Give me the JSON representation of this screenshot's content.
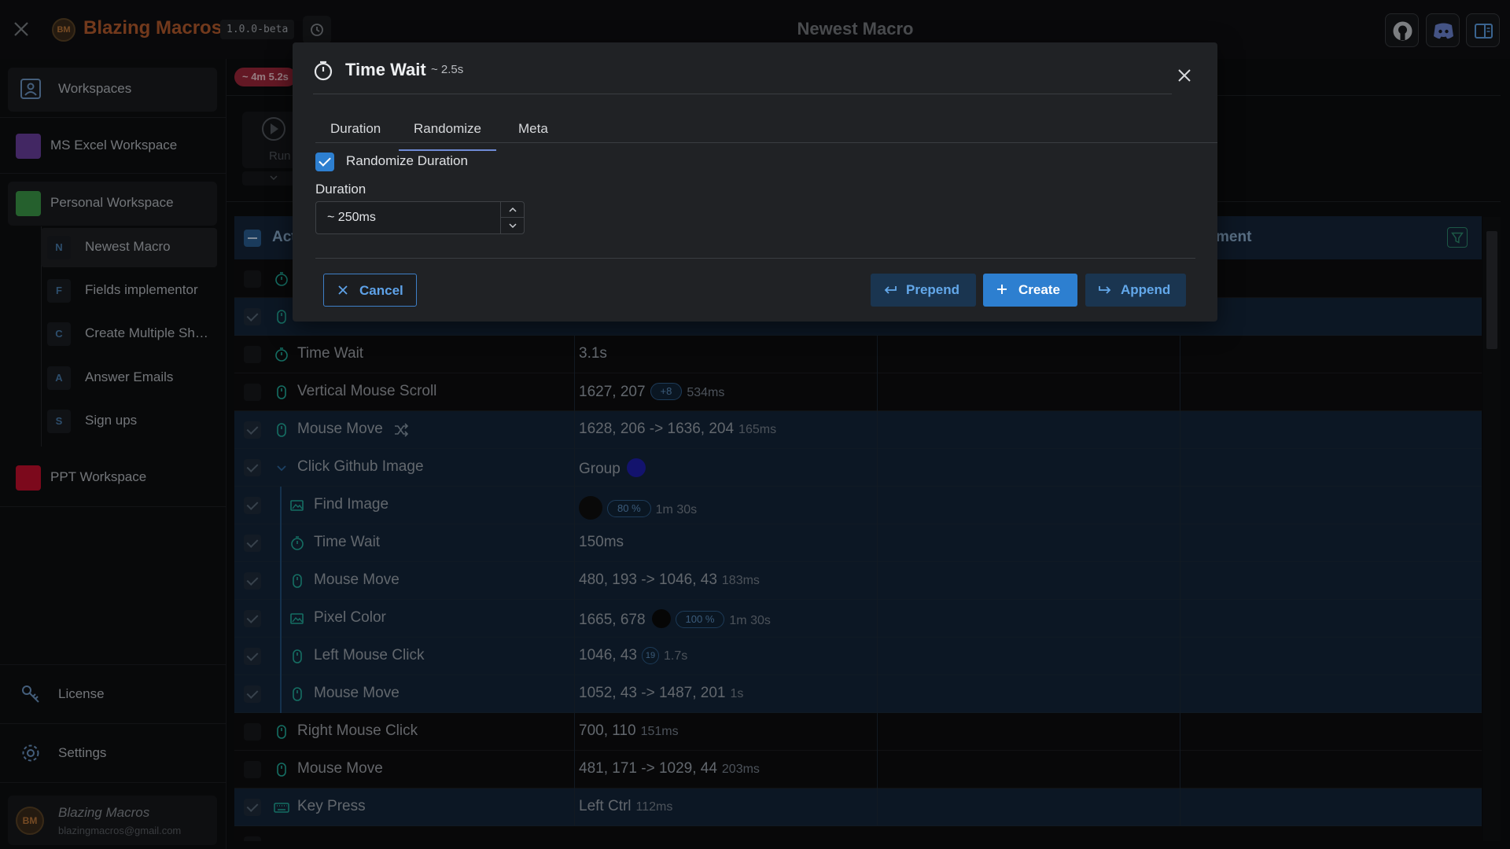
{
  "app": {
    "logo_text": "BM",
    "name": "Blazing Macros",
    "version": "1.0.0-beta",
    "window_title": "Newest Macro"
  },
  "sidebar": {
    "workspaces_label": "Workspaces",
    "workspaces": [
      {
        "label": "MS Excel Workspace",
        "color": "#6b3fa0"
      },
      {
        "label": "Personal Workspace",
        "color": "#3c9b4a"
      },
      {
        "label": "PPT Workspace",
        "color": "#c8102e"
      }
    ],
    "macros": [
      {
        "badge": "N",
        "label": "Newest Macro"
      },
      {
        "badge": "F",
        "label": "Fields implementor"
      },
      {
        "badge": "C",
        "label": "Create Multiple Sh…"
      },
      {
        "badge": "A",
        "label": "Answer Emails"
      },
      {
        "badge": "S",
        "label": "Sign ups"
      }
    ],
    "license_label": "License",
    "settings_label": "Settings",
    "user": {
      "name": "Blazing Macros",
      "email": "blazingmacros@gmail.com"
    }
  },
  "main": {
    "total_time": "~ 4m 5.2s",
    "run_label": "Run",
    "table": {
      "header_action": "Acti",
      "header_comment": "ment",
      "rows": [
        {
          "name": "Time Wait",
          "value": "3.1s",
          "extra": "",
          "pill": ""
        },
        {
          "name": "Vertical Mouse Scroll",
          "value": "1627, 207",
          "pill": "+8",
          "extra": "534ms"
        },
        {
          "name": "Mouse Move",
          "value": "1628, 206 -> 1636, 204",
          "pill": "",
          "extra": "165ms"
        },
        {
          "name": "Click Github Image",
          "value": "Group",
          "pill": "",
          "extra": ""
        },
        {
          "name": "Find Image",
          "value": "",
          "pill": "80 %",
          "extra": "1m 30s"
        },
        {
          "name": "Time Wait",
          "value": "150ms",
          "pill": "",
          "extra": ""
        },
        {
          "name": "Mouse Move",
          "value": "480, 193 -> 1046, 43",
          "pill": "",
          "extra": "183ms"
        },
        {
          "name": "Pixel Color",
          "value": "1665, 678",
          "pill": "100 %",
          "extra": "1m 30s"
        },
        {
          "name": "Left Mouse Click",
          "value": "1046, 43",
          "pill": "19",
          "extra": "1.7s"
        },
        {
          "name": "Mouse Move",
          "value": "1052, 43 -> 1487, 201",
          "pill": "",
          "extra": "1s"
        },
        {
          "name": "Right Mouse Click",
          "value": "700, 110",
          "pill": "",
          "extra": "151ms"
        },
        {
          "name": "Mouse Move",
          "value": "481, 171 -> 1029, 44",
          "pill": "",
          "extra": "203ms"
        },
        {
          "name": "Key Press",
          "value": "Left Ctrl",
          "pill": "",
          "extra": "112ms"
        }
      ]
    }
  },
  "modal": {
    "title": "Time Wait",
    "subtitle": "~ 2.5s",
    "tabs": [
      "Duration",
      "Randomize",
      "Meta"
    ],
    "active_tab": "Randomize",
    "randomize_label": "Randomize Duration",
    "randomize_checked": true,
    "duration_label": "Duration",
    "duration_value": "~ 250ms",
    "buttons": {
      "cancel": "Cancel",
      "prepend": "Prepend",
      "create": "Create",
      "append": "Append"
    }
  },
  "colors": {
    "accent": "#2d7fd0",
    "group_dot": "#1f1fb0",
    "pixel_dot": "#0a0a0a",
    "total_time_badge": "#a1273b"
  }
}
